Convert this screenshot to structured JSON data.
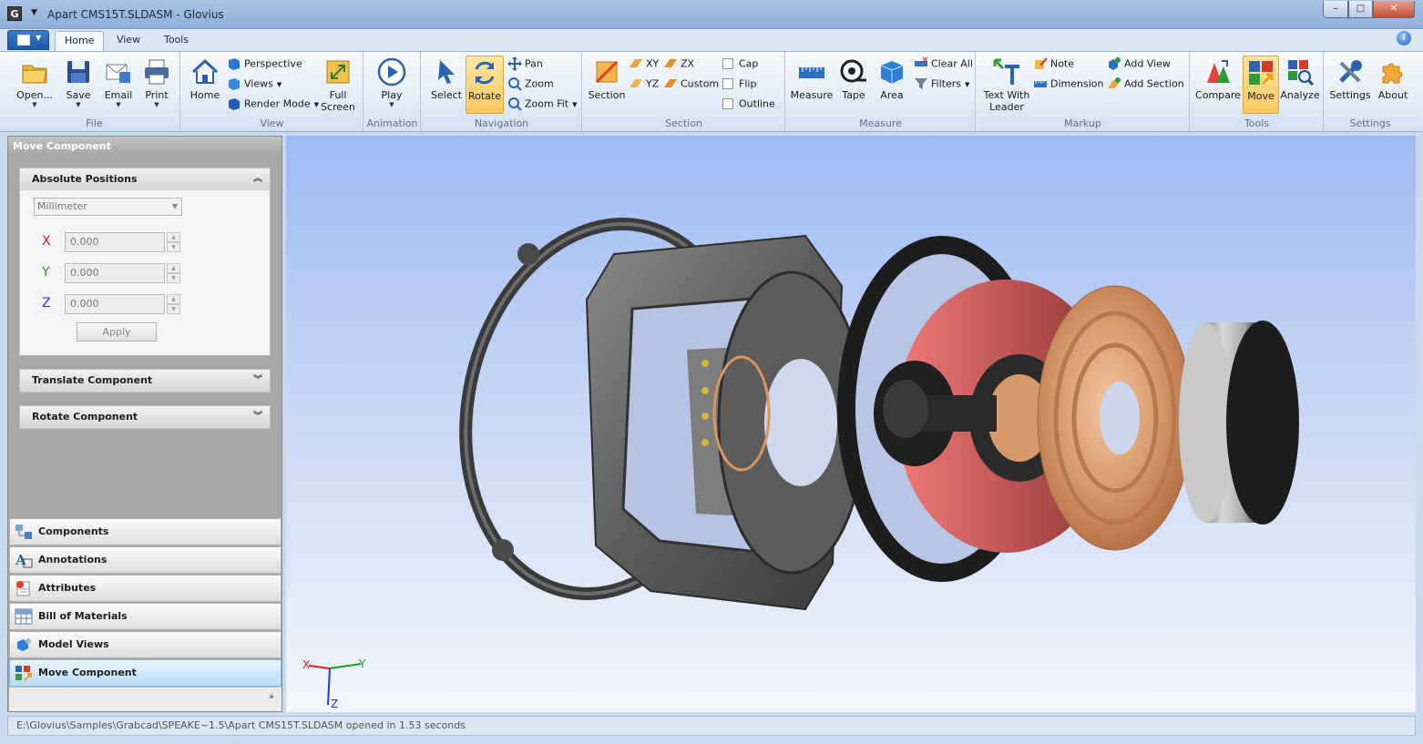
{
  "window": {
    "app_icon_letter": "G",
    "title": "Apart CMS15T.SLDASM - Glovius",
    "min": "‒",
    "max": "□",
    "close": "✕"
  },
  "tabs": [
    {
      "label": "Home",
      "active": true
    },
    {
      "label": "View",
      "active": false
    },
    {
      "label": "Tools",
      "active": false
    }
  ],
  "ribbon": {
    "file": {
      "label": "File",
      "open": "Open...",
      "save": "Save",
      "email": "Email",
      "print": "Print"
    },
    "view": {
      "label": "View",
      "home": "Home",
      "perspective": "Perspective",
      "views": "Views",
      "render_mode": "Render Mode",
      "full_screen_1": "Full",
      "full_screen_2": "Screen"
    },
    "animation": {
      "label": "Animation",
      "play": "Play"
    },
    "navigation": {
      "label": "Navigation",
      "select": "Select",
      "rotate": "Rotate",
      "pan": "Pan",
      "zoom": "Zoom",
      "zoom_fit": "Zoom Fit"
    },
    "section": {
      "label": "Section",
      "section": "Section",
      "xy": "XY",
      "zx": "ZX",
      "yz": "YZ",
      "custom": "Custom",
      "cap": "Cap",
      "flip": "Flip",
      "outline": "Outline"
    },
    "measure": {
      "label": "Measure",
      "measure": "Measure",
      "tape": "Tape",
      "area": "Area",
      "clear_all": "Clear All",
      "filters": "Filters"
    },
    "markup": {
      "label": "Markup",
      "text_with_leader_1": "Text With",
      "text_with_leader_2": "Leader",
      "note": "Note",
      "dimension": "Dimension",
      "add_view": "Add View",
      "add_section": "Add Section"
    },
    "tools": {
      "label": "Tools",
      "compare": "Compare",
      "move": "Move",
      "analyze": "Analyze"
    },
    "settings": {
      "label": "Settings",
      "settings": "Settings",
      "about": "About"
    }
  },
  "left_panel": {
    "title": "Move Component",
    "absolute_positions": {
      "header": "Absolute Positions",
      "unit": "Millimeter",
      "x_label": "X",
      "y_label": "Y",
      "z_label": "Z",
      "x_value": "0.000",
      "y_value": "0.000",
      "z_value": "0.000",
      "apply": "Apply"
    },
    "translate_header": "Translate Component",
    "rotate_header": "Rotate Component",
    "nav": [
      "Components",
      "Annotations",
      "Attributes",
      "Bill of Materials",
      "Model Views",
      "Move Component"
    ]
  },
  "viewport": {
    "axis_x": "X",
    "axis_y": "Y",
    "axis_z": "Z"
  },
  "status": {
    "text": "E:\\Glovius\\Samples\\Grabcad\\SPEAKE~1.5\\Apart CMS15T.SLDASM opened in 1.53 seconds"
  },
  "colors": {
    "accent": "#1d5aa8",
    "active_button": "#f8c862",
    "axis_x": "#e02020",
    "axis_y": "#19a019",
    "axis_z": "#1f3fc0"
  }
}
